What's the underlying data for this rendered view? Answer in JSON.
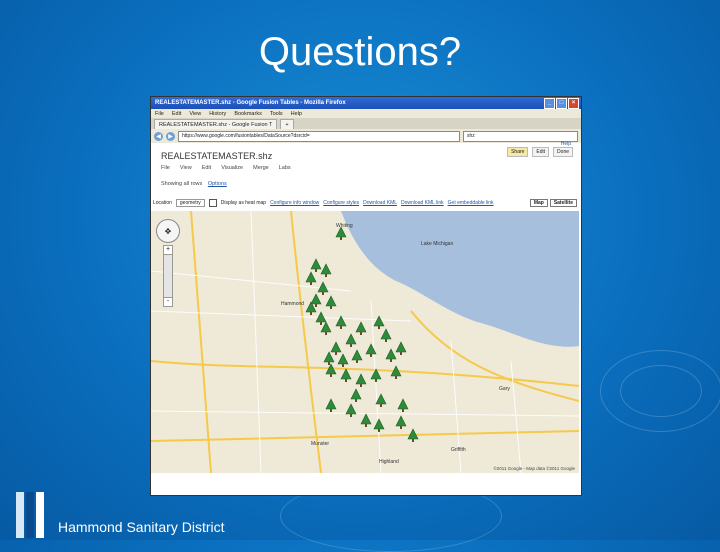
{
  "slide": {
    "title": "Questions?",
    "footer": "Hammond Sanitary District"
  },
  "browser": {
    "window_title": "REALESTATEMASTER.shz - Google Fusion Tables - Mozilla Firefox",
    "menu": [
      "File",
      "Edit",
      "View",
      "History",
      "Bookmarks",
      "Tools",
      "Help"
    ],
    "tab_label": "REALESTATEMASTER.shz - Google Fusion T",
    "new_tab": "+",
    "url": "https://www.google.com/fusiontables/DataSource?dsrcid=",
    "search_value": "shz"
  },
  "app": {
    "help_link": "Help",
    "buttons": [
      "Share",
      "Edit",
      "Done"
    ],
    "doc_title": "REALESTATEMASTER.shz",
    "doc_menu": [
      "File",
      "View",
      "Edit",
      "Visualize",
      "Merge",
      "Labs"
    ],
    "showing_text": "Showing all rows",
    "options_link": "Options",
    "location_label": "Location",
    "location_select": "geometry",
    "heatmap_label": "Display as heat map",
    "links": [
      "Configure info window",
      "Configure styles",
      "Download KML",
      "Download KML link",
      "Get embeddable link"
    ],
    "map_types": [
      "Map",
      "Satellite"
    ]
  },
  "map": {
    "pan_icon": "pan-control-icon",
    "zoom_in": "+",
    "zoom_out": "-",
    "labels": [
      "Lake Michigan",
      "Whiting",
      "Hammond",
      "Munster",
      "Gary",
      "Griffith",
      "Highland"
    ],
    "copyright": "©2011 Google - Map data ©2011 Google"
  },
  "colors": {
    "slide_bg": "#0a6fbf",
    "marker": "#2e8b3a"
  }
}
